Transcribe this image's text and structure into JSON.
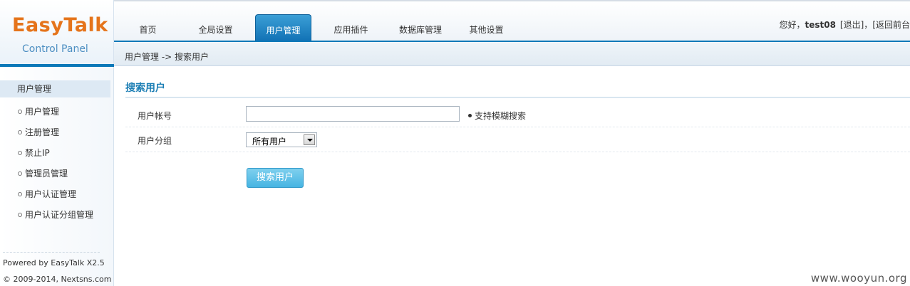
{
  "logo": {
    "title": "EasyTalk",
    "subtitle": "Control Panel"
  },
  "nav": {
    "items": [
      {
        "label": "首页"
      },
      {
        "label": "全局设置"
      },
      {
        "label": "用户管理",
        "active": true
      },
      {
        "label": "应用插件"
      },
      {
        "label": "数据库管理"
      },
      {
        "label": "其他设置"
      }
    ]
  },
  "user_info": {
    "greeting": "您好，",
    "username": "test08",
    "logout": "[退出]",
    "separator": "，",
    "back_front": "[返回前台"
  },
  "breadcrumb": "用户管理 -> 搜索用户",
  "sidebar": {
    "header": "用户管理",
    "items": [
      {
        "label": "用户管理"
      },
      {
        "label": "注册管理"
      },
      {
        "label": "禁止IP"
      },
      {
        "label": "管理员管理"
      },
      {
        "label": "用户认证管理"
      },
      {
        "label": "用户认证分组管理"
      }
    ],
    "powered": "Powered by EasyTalk X2.5",
    "copyright": "© 2009-2014, Nextsns.com"
  },
  "main": {
    "section_title": "搜索用户",
    "form": {
      "account_label": "用户帐号",
      "account_value": "",
      "fuzzy_hint": "支持模糊搜索",
      "group_label": "用户分组",
      "group_selected": "所有用户"
    },
    "search_button": "搜索用户"
  },
  "watermark": "www.wooyun.org",
  "colors": {
    "accent": "#0b78b8",
    "logo_orange": "#e5741b",
    "button": "#46b4e2"
  }
}
